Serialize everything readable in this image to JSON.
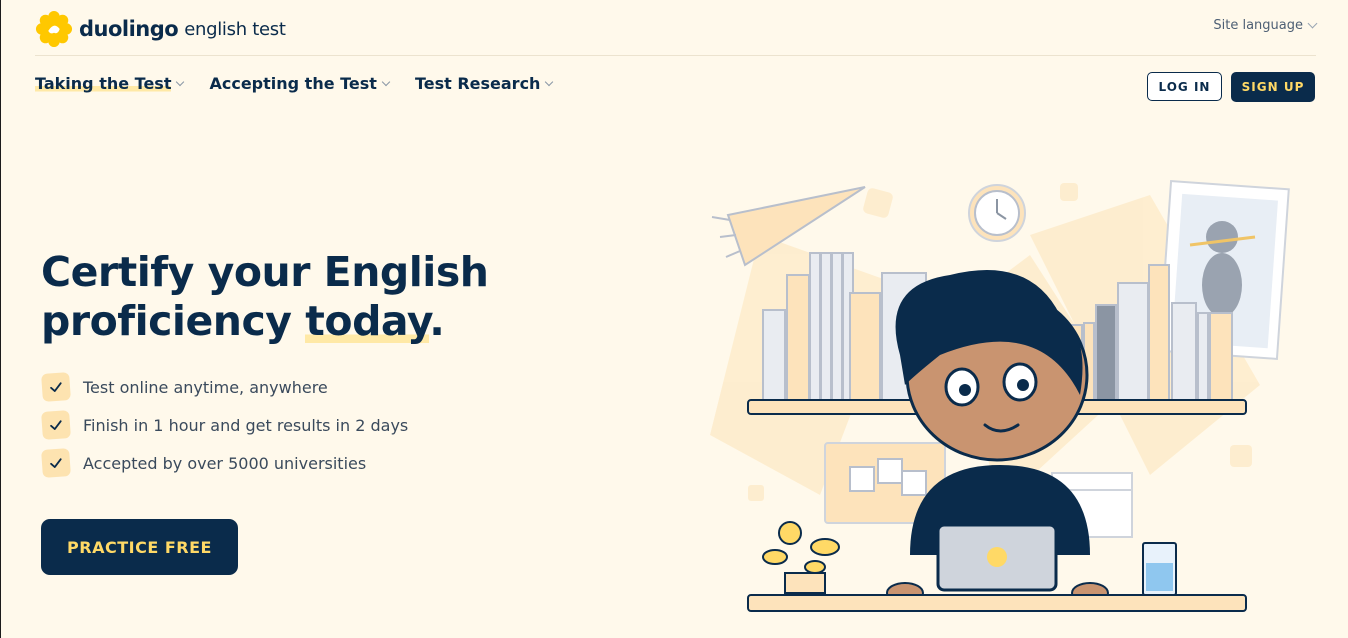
{
  "header": {
    "logo_word": "duolingo",
    "logo_sub": "english test",
    "site_language_label": "Site language"
  },
  "nav": {
    "items": [
      {
        "label": "Taking the Test",
        "active": true
      },
      {
        "label": "Accepting the Test",
        "active": false
      },
      {
        "label": "Test Research",
        "active": false
      }
    ],
    "login_label": "LOG IN",
    "signup_label": "SIGN UP"
  },
  "hero": {
    "title_part1": "Certify your English",
    "title_part2": "proficiency ",
    "title_highlight": "today",
    "title_end": ".",
    "features": [
      "Test online anytime, anywhere",
      "Finish in 1 hour and get results in 2 days",
      "Accepted by over 5000 universities"
    ],
    "cta_label": "PRACTICE FREE"
  },
  "colors": {
    "navy": "#0a2b4b",
    "yellow": "#ffd966",
    "background": "#fff9eb",
    "highlight": "#ffe9a6"
  }
}
